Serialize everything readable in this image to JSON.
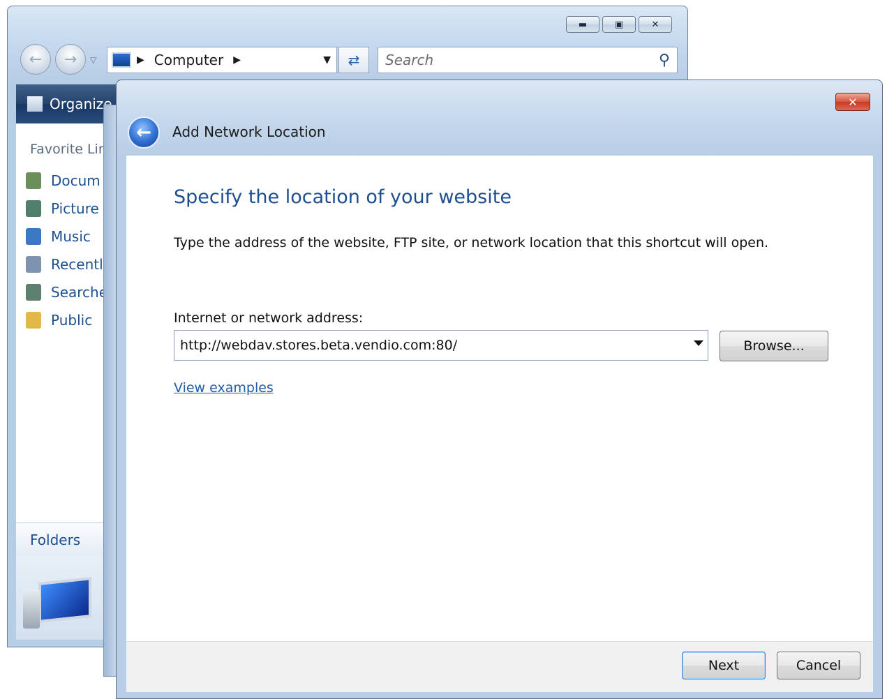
{
  "explorer": {
    "address": {
      "path": [
        "Computer"
      ]
    },
    "search": {
      "placeholder": "Search"
    },
    "toolbar": {
      "organize_label": "Organize"
    },
    "favorites": {
      "header": "Favorite Lir",
      "items": [
        {
          "label": "Docum",
          "icon": "documents-icon",
          "color": "#6b8f5a"
        },
        {
          "label": "Picture",
          "icon": "pictures-icon",
          "color": "#4f7f6a"
        },
        {
          "label": "Music",
          "icon": "music-icon",
          "color": "#3b78c4"
        },
        {
          "label": "Recentl",
          "icon": "recent-items-icon",
          "color": "#7d93b0"
        },
        {
          "label": "Searche",
          "icon": "searches-icon",
          "color": "#5d7f6d"
        },
        {
          "label": "Public",
          "icon": "folder-icon",
          "color": "#e2b84a"
        }
      ]
    },
    "folders_label": "Folders"
  },
  "dialog": {
    "title": "Add Network Location",
    "heading": "Specify the location of your website",
    "description": "Type the address of the website, FTP site, or network location that this shortcut will open.",
    "address_label": "Internet or network address:",
    "address_value": "http://webdav.stores.beta.vendio.com:80/",
    "browse_label": "Browse...",
    "examples_link": "View examples",
    "next_label": "Next",
    "cancel_label": "Cancel"
  },
  "colors": {
    "heading_blue": "#1f4e8f",
    "link_blue": "#1f5ca8",
    "toolbar_navy": "#24446d",
    "close_red": "#c63a22"
  }
}
